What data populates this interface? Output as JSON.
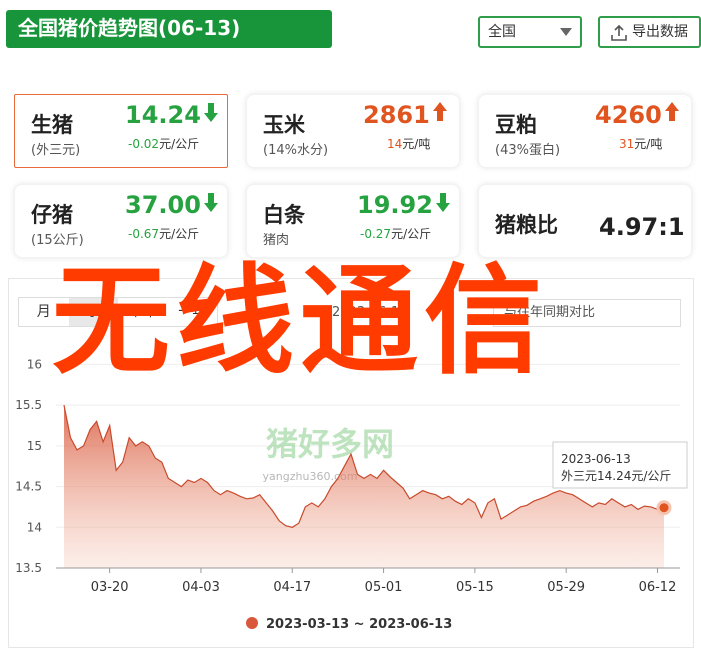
{
  "header": {
    "title": "全国猪价趋势图(06-13)",
    "region": "全国",
    "export_label": "导出数据"
  },
  "cards": [
    {
      "name": "生猪",
      "sub": "(外三元)",
      "price": "14.24",
      "direction": "down",
      "change": "-0.02",
      "unit": "元/公斤"
    },
    {
      "name": "玉米",
      "sub": "(14%水分)",
      "price": "2861",
      "direction": "up",
      "change": "14",
      "unit": "元/吨"
    },
    {
      "name": "豆粕",
      "sub": "(43%蛋白)",
      "price": "4260",
      "direction": "up",
      "change": "31",
      "unit": "元/吨"
    },
    {
      "name": "仔猪",
      "sub": "(15公斤)",
      "price": "37.00",
      "direction": "down",
      "change": "-0.67",
      "unit": "元/公斤"
    },
    {
      "name": "白条",
      "sub": "猪肉",
      "price": "19.92",
      "direction": "down",
      "change": "-0.27",
      "unit": "元/公斤"
    },
    {
      "name": "猪粮比",
      "sub": "",
      "price": "4.97:1",
      "direction": "none",
      "change": "",
      "unit": ""
    }
  ],
  "chart_controls": {
    "tabs": [
      "月",
      "季",
      "半年",
      "一年"
    ],
    "active_tab": "季",
    "date_text": "2023-06-13",
    "compare_text": "与往年同期对比"
  },
  "overlay_text": "无线通信",
  "colors": {
    "green": "#26a340",
    "red": "#e0541f",
    "header_green": "#18953a",
    "area": "#d9573a",
    "overlay": "#ff3b00"
  },
  "chart_data": {
    "type": "area",
    "ylim": [
      13.5,
      16.3
    ],
    "yticks": [
      "16",
      "15.5",
      "15",
      "14.5",
      "14",
      "13.5"
    ],
    "xticks": [
      "03-20",
      "04-03",
      "04-17",
      "05-01",
      "05-15",
      "05-29",
      "06-12"
    ],
    "grid": true,
    "legend": "2023-03-13 ~ 2023-06-13",
    "legend_position": "bottom",
    "tooltip": {
      "date": "2023-06-13",
      "label": "外三元14.24元/公斤"
    },
    "watermark_text": "猪好多网",
    "watermark_url": "yangzhu360.com",
    "x": [
      "03-13",
      "03-14",
      "03-15",
      "03-16",
      "03-17",
      "03-18",
      "03-19",
      "03-20",
      "03-21",
      "03-22",
      "03-23",
      "03-24",
      "03-25",
      "03-26",
      "03-27",
      "03-28",
      "03-29",
      "03-30",
      "03-31",
      "04-01",
      "04-02",
      "04-03",
      "04-04",
      "04-05",
      "04-06",
      "04-07",
      "04-08",
      "04-09",
      "04-10",
      "04-11",
      "04-12",
      "04-13",
      "04-14",
      "04-15",
      "04-16",
      "04-17",
      "04-18",
      "04-19",
      "04-20",
      "04-21",
      "04-22",
      "04-23",
      "04-24",
      "04-25",
      "04-26",
      "04-27",
      "04-28",
      "04-29",
      "04-30",
      "05-01",
      "05-02",
      "05-03",
      "05-04",
      "05-05",
      "05-06",
      "05-07",
      "05-08",
      "05-09",
      "05-10",
      "05-11",
      "05-12",
      "05-13",
      "05-14",
      "05-15",
      "05-16",
      "05-17",
      "05-18",
      "05-19",
      "05-20",
      "05-21",
      "05-22",
      "05-23",
      "05-24",
      "05-25",
      "05-26",
      "05-27",
      "05-28",
      "05-29",
      "05-30",
      "05-31",
      "06-01",
      "06-02",
      "06-03",
      "06-04",
      "06-05",
      "06-06",
      "06-07",
      "06-08",
      "06-09",
      "06-10",
      "06-11",
      "06-12",
      "06-13"
    ],
    "values": [
      15.5,
      15.1,
      14.95,
      15.0,
      15.2,
      15.3,
      15.05,
      15.25,
      14.7,
      14.8,
      15.1,
      15.0,
      15.05,
      15.0,
      14.85,
      14.8,
      14.6,
      14.55,
      14.5,
      14.58,
      14.55,
      14.6,
      14.55,
      14.45,
      14.4,
      14.45,
      14.42,
      14.38,
      14.35,
      14.36,
      14.4,
      14.3,
      14.2,
      14.08,
      14.02,
      14.0,
      14.05,
      14.25,
      14.3,
      14.25,
      14.35,
      14.5,
      14.6,
      14.75,
      14.9,
      14.65,
      14.6,
      14.65,
      14.6,
      14.7,
      14.62,
      14.55,
      14.48,
      14.35,
      14.4,
      14.45,
      14.42,
      14.4,
      14.35,
      14.38,
      14.32,
      14.28,
      14.35,
      14.3,
      14.12,
      14.3,
      14.35,
      14.1,
      14.15,
      14.2,
      14.25,
      14.27,
      14.32,
      14.35,
      14.38,
      14.42,
      14.45,
      14.42,
      14.4,
      14.35,
      14.3,
      14.25,
      14.3,
      14.28,
      14.35,
      14.3,
      14.25,
      14.28,
      14.22,
      14.26,
      14.25,
      14.22,
      14.24
    ]
  }
}
